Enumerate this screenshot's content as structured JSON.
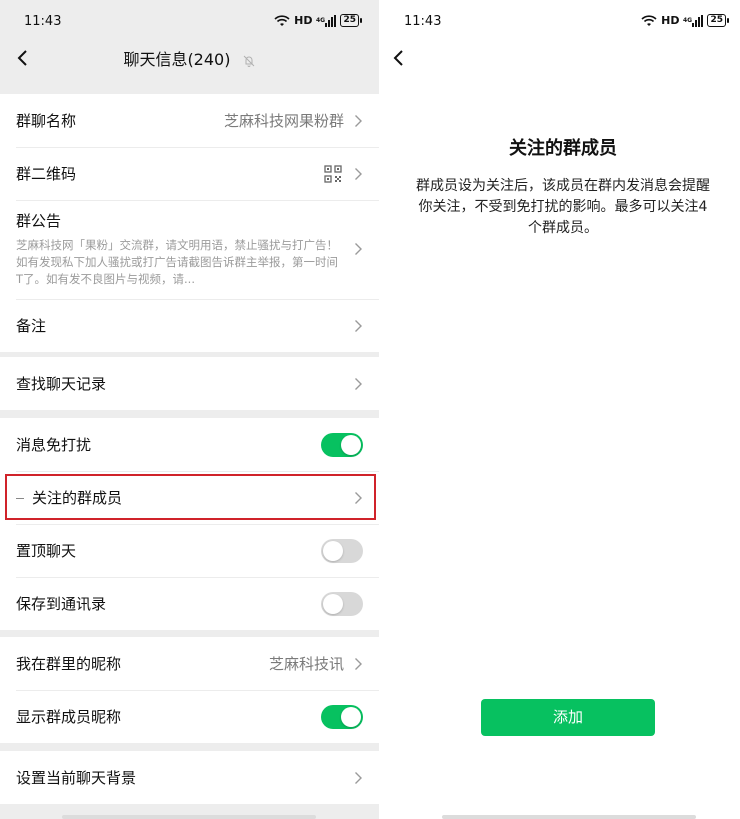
{
  "left": {
    "status": {
      "time": "11:43",
      "hd": "HD",
      "battery": "25"
    },
    "nav": {
      "title": "聊天信息(240)",
      "back_icon": "back-chevron-icon",
      "mute_icon": "bell-off-icon"
    },
    "groups": [
      {
        "rows": [
          {
            "label": "群聊名称",
            "value": "芝麻科技网果粉群"
          },
          {
            "label": "群二维码",
            "icon": "qr-code-icon"
          },
          {
            "label": "群公告",
            "body": "芝麻科技网「果粉」交流群，请文明用语，禁止骚扰与打广告！如有发现私下加人骚扰或打广告请截图告诉群主举报，第一时间T了。如有发不良图片与视频，请..."
          },
          {
            "label": "备注"
          }
        ]
      },
      {
        "rows": [
          {
            "label": "查找聊天记录"
          }
        ]
      },
      {
        "rows": [
          {
            "label": "消息免打扰",
            "toggle": true
          },
          {
            "label": "关注的群成员"
          },
          {
            "label": "置顶聊天",
            "toggle": false
          },
          {
            "label": "保存到通讯录",
            "toggle": false
          }
        ]
      },
      {
        "rows": [
          {
            "label": "我在群里的昵称",
            "value": "芝麻科技讯"
          },
          {
            "label": "显示群成员昵称",
            "toggle": true
          }
        ]
      },
      {
        "rows": [
          {
            "label": "设置当前聊天背景"
          }
        ]
      }
    ],
    "highlight_color": "#d0232a"
  },
  "right": {
    "status": {
      "time": "11:43",
      "hd": "HD",
      "battery": "25"
    },
    "title": "关注的群成员",
    "description": "群成员设为关注后，该成员在群内发消息会提醒你关注，不受到免打扰的影响。最多可以关注4个群成员。",
    "add_button": "添加"
  },
  "colors": {
    "accent": "#07c160",
    "background": "#ededed",
    "toggle_off": "#d8d8d8"
  }
}
